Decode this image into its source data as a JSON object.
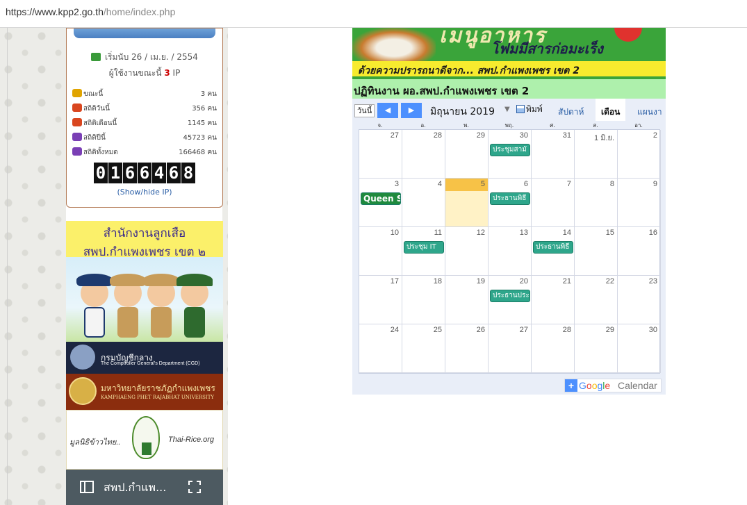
{
  "browser": {
    "url_host": "https://www.kpp2.go.th",
    "url_path": "/home/index.php"
  },
  "stats": {
    "start_label": "เริ่มนับ 26 / เม.ย. / 2554",
    "online_prefix": "ผู้ใช้งานขณะนี้",
    "online_count": "3",
    "online_suffix": "IP",
    "rows": [
      {
        "label": "ขณะนี้",
        "value": "3 คน",
        "icon": "person-icon"
      },
      {
        "label": "สถิติวันนี้",
        "value": "356 คน",
        "icon": "group-icon"
      },
      {
        "label": "สถิติเดือนนี้",
        "value": "1145 คน",
        "icon": "group-icon"
      },
      {
        "label": "สถิติปีนี้",
        "value": "45723 คน",
        "icon": "crowd-icon"
      },
      {
        "label": "สถิติทั้งหมด",
        "value": "166468 คน",
        "icon": "crowd-icon"
      }
    ],
    "counter_digits": [
      "0",
      "1",
      "6",
      "6",
      "4",
      "6",
      "8"
    ],
    "toggle_label": "(Show/hide IP)"
  },
  "banners": {
    "scout_line1": "สำนักงานลูกเสือ",
    "scout_line2": "สพป.กำแพงเพชร เขต ๒",
    "cgd_name": "กรมบัญชีกลาง",
    "cgd_en": "The Comptroller General's Department (CGD)",
    "kpru_name": "มหาวิทยาลัยราชภัฏกำแพงเพชร",
    "kpru_en": "KAMPHAENG PHET RAJABHAT UNIVERSITY",
    "rice_left": "มูลนิธิข้าวไทย..",
    "rice_right": "Thai-Rice.org",
    "bottom_title": "สพป.กำแพ..."
  },
  "header_banner": {
    "big_text": "เมนูอาหาร",
    "sub_text": "โฟมมีสารก่อมะเร็ง",
    "credit_text": "ด้วยความปรารถนาดีจาก...  สพป.กำแพงเพชร เขต 2"
  },
  "calendar": {
    "title": "ปฏิทินงาน ผอ.สพป.กำแพงเพชร เขต 2",
    "today_button": "วันนี้",
    "prev_icon": "◀",
    "next_icon": "▶",
    "month_label": "มิถุนายน 2019",
    "print_label": "พิมพ์",
    "tabs": {
      "week": "สัปดาห์",
      "month": "เดือน",
      "agenda": "แผนงา"
    },
    "weekdays": [
      "จ.",
      "อ.",
      "พ.",
      "พฤ.",
      "ศ.",
      "ส.",
      "อา."
    ],
    "weeks": [
      [
        {
          "day": "27"
        },
        {
          "day": "28"
        },
        {
          "day": "29"
        },
        {
          "day": "30",
          "event": "ประชุมสามั"
        },
        {
          "day": "31"
        },
        {
          "day": "1 มิ.ย."
        },
        {
          "day": "2"
        }
      ],
      [
        {
          "day": "3",
          "event": "Queen S",
          "event_style": "dark"
        },
        {
          "day": "4"
        },
        {
          "day": "5",
          "today": true
        },
        {
          "day": "6",
          "event": "ประธานพิธี"
        },
        {
          "day": "7"
        },
        {
          "day": "8"
        },
        {
          "day": "9"
        }
      ],
      [
        {
          "day": "10"
        },
        {
          "day": "11",
          "event": "ประชุม IT"
        },
        {
          "day": "12"
        },
        {
          "day": "13"
        },
        {
          "day": "14",
          "event": "ประธานพิธี"
        },
        {
          "day": "15"
        },
        {
          "day": "16"
        }
      ],
      [
        {
          "day": "17"
        },
        {
          "day": "18"
        },
        {
          "day": "19"
        },
        {
          "day": "20",
          "event": "ประธานประ"
        },
        {
          "day": "21"
        },
        {
          "day": "22"
        },
        {
          "day": "23"
        }
      ],
      [
        {
          "day": "24"
        },
        {
          "day": "25"
        },
        {
          "day": "26"
        },
        {
          "day": "27"
        },
        {
          "day": "28"
        },
        {
          "day": "29"
        },
        {
          "day": "30"
        }
      ]
    ],
    "gcal_google": "Google",
    "gcal_calendar": "Calendar"
  }
}
